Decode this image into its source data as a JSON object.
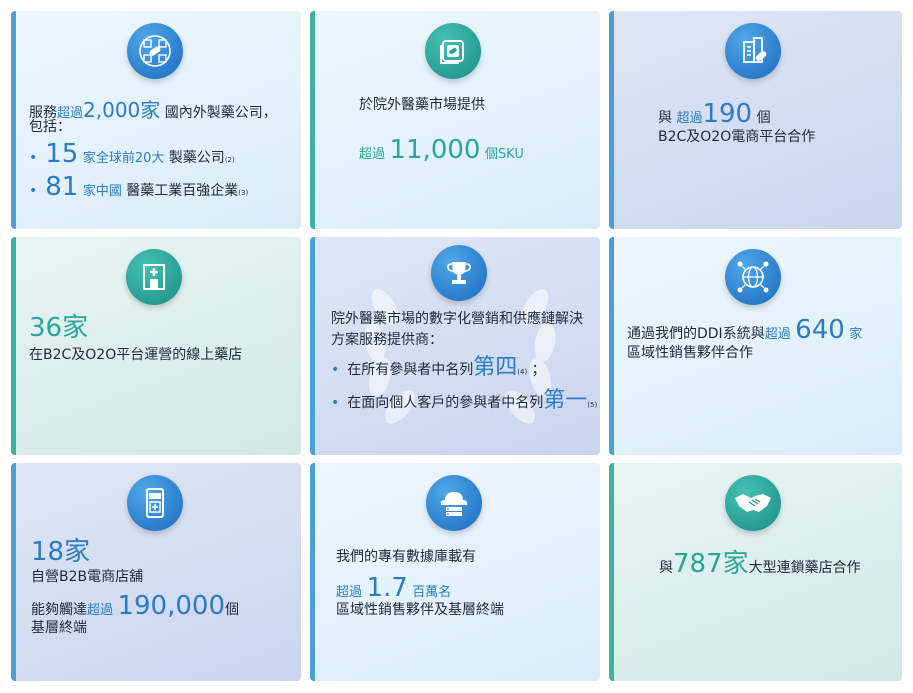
{
  "cards": [
    {
      "icon": "pharma-cube-icon",
      "line1_pre": "服務",
      "line1_mid": "超過",
      "line1_big": "2,000家",
      "line1_post": "國內外製藥公司，",
      "line2": "包括：",
      "bullets": [
        {
          "big": "15",
          "mid": "家全球前20大",
          "post": "製藥公司",
          "sup": "(2)"
        },
        {
          "big": "81",
          "mid": "家中國",
          "post": "醫藥工業百強企業",
          "sup": "(3)"
        }
      ]
    },
    {
      "icon": "pill-box-icon",
      "line1": "於院外醫藥市場提供",
      "mid": "超過",
      "big": "11,000",
      "post": "個SKU"
    },
    {
      "icon": "building-pill-icon",
      "pre": "與",
      "mid": "超過",
      "big": "190",
      "post": "個",
      "line2": "B2C及O2O電商平台合作"
    },
    {
      "icon": "pharmacy-icon",
      "big": "36家",
      "line2": "在B2C及O2O平台運營的線上藥店"
    },
    {
      "icon": "trophy-icon",
      "line1": "院外醫藥市場的數字化營銷和供應鏈解決",
      "line2": "方案服務提供商：",
      "bullets": [
        {
          "text": "在所有參與者中名列",
          "big": "第四",
          "sup": "(4)",
          "post": "；"
        },
        {
          "text": "在面向個人客戶的參與者中名列",
          "big": "第一",
          "sup": "(5)",
          "post": ""
        }
      ]
    },
    {
      "icon": "network-globe-icon",
      "pre": "通過我們的DDI系統與",
      "mid": "超過",
      "big": "640",
      "post": "家",
      "line2": "區域性銷售夥伴合作"
    },
    {
      "icon": "mobile-store-icon",
      "big": "18家",
      "line2": "自營B2B電商店舖",
      "line3_pre": "能夠觸達",
      "line3_mid": "超過",
      "line3_big": "190,000",
      "line3_post": "個",
      "line4": "基層終端"
    },
    {
      "icon": "cloud-database-icon",
      "line1": "我們的專有數據庫載有",
      "mid": "超過",
      "big": "1.7",
      "post": "百萬名",
      "line3": "區域性銷售夥伴及基層終端"
    },
    {
      "icon": "handshake-icon",
      "pre": "與",
      "big": "787家",
      "post": "大型連鎖藥店合作"
    }
  ]
}
